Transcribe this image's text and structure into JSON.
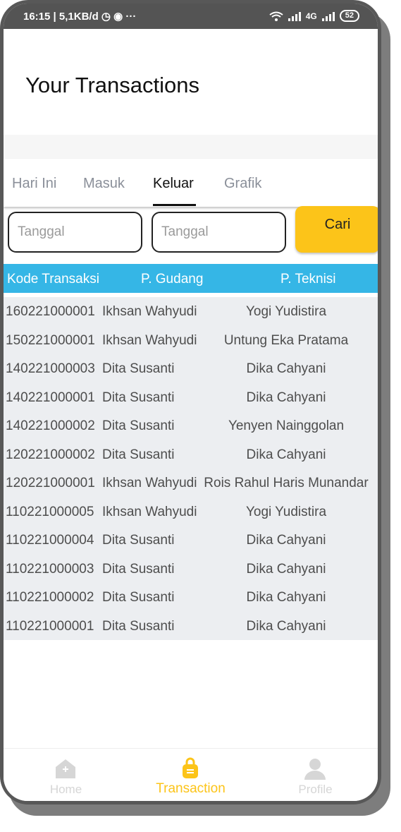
{
  "status_bar": {
    "left_text": "16:15 | 5,1KB/d ◷ ◉  ···",
    "signal_label": "4G",
    "battery": "52"
  },
  "header": {
    "title": "Your Transactions"
  },
  "tabs": [
    {
      "label": "Hari Ini",
      "active": false
    },
    {
      "label": "Masuk",
      "active": false
    },
    {
      "label": "Keluar",
      "active": true
    },
    {
      "label": "Grafik",
      "active": false
    }
  ],
  "filters": {
    "start_date_placeholder": "Tanggal",
    "end_date_placeholder": "Tanggal",
    "search_button": "Cari"
  },
  "table": {
    "columns": [
      "Kode Transaksi",
      "P. Gudang",
      "P. Teknisi"
    ],
    "rows": [
      [
        "160221000001",
        "Ikhsan Wahyudi",
        "Yogi Yudistira"
      ],
      [
        "150221000001",
        "Ikhsan Wahyudi",
        "Untung Eka Pratama"
      ],
      [
        "140221000003",
        "Dita Susanti",
        "Dika Cahyani"
      ],
      [
        "140221000001",
        "Dita Susanti",
        "Dika Cahyani"
      ],
      [
        "140221000002",
        "Dita Susanti",
        "Yenyen Nainggolan"
      ],
      [
        "120221000002",
        "Dita Susanti",
        "Dika Cahyani"
      ],
      [
        "120221000001",
        "Ikhsan Wahyudi",
        "Rois Rahul Haris Munandar"
      ],
      [
        "110221000005",
        "Ikhsan Wahyudi",
        "Yogi Yudistira"
      ],
      [
        "110221000004",
        "Dita Susanti",
        "Dika Cahyani"
      ],
      [
        "110221000003",
        "Dita Susanti",
        "Dika Cahyani"
      ],
      [
        "110221000002",
        "Dita Susanti",
        "Dika Cahyani"
      ],
      [
        "110221000001",
        "Dita Susanti",
        "Dika Cahyani"
      ]
    ]
  },
  "bottom_nav": [
    {
      "label": "Home",
      "icon": "home-icon",
      "active": false
    },
    {
      "label": "Transaction",
      "icon": "shopping-bag-icon",
      "active": true
    },
    {
      "label": "Profile",
      "icon": "person-icon",
      "active": false
    }
  ],
  "colors": {
    "accent": "#fcc419",
    "table_header": "#35b6e6",
    "table_body": "#eceef1"
  }
}
